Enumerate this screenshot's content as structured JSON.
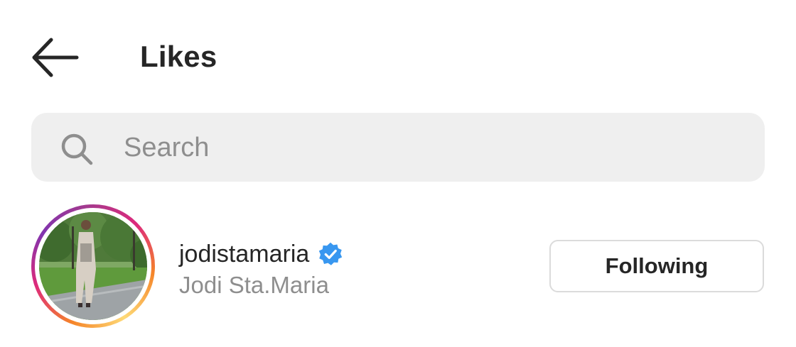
{
  "header": {
    "back_icon": "arrow-left-icon",
    "title": "Likes"
  },
  "search": {
    "icon": "search-icon",
    "placeholder": "Search",
    "value": ""
  },
  "likes": [
    {
      "username": "jodistamaria",
      "full_name": "Jodi Sta.Maria",
      "verified": true,
      "verified_icon": "verified-badge-icon",
      "story_ring": true,
      "button_label": "Following"
    }
  ],
  "colors": {
    "text_primary": "#262626",
    "text_secondary": "#8e8e8e",
    "search_bg": "#efefef",
    "verified_blue": "#3897f0",
    "button_border": "#dbdbdb"
  }
}
